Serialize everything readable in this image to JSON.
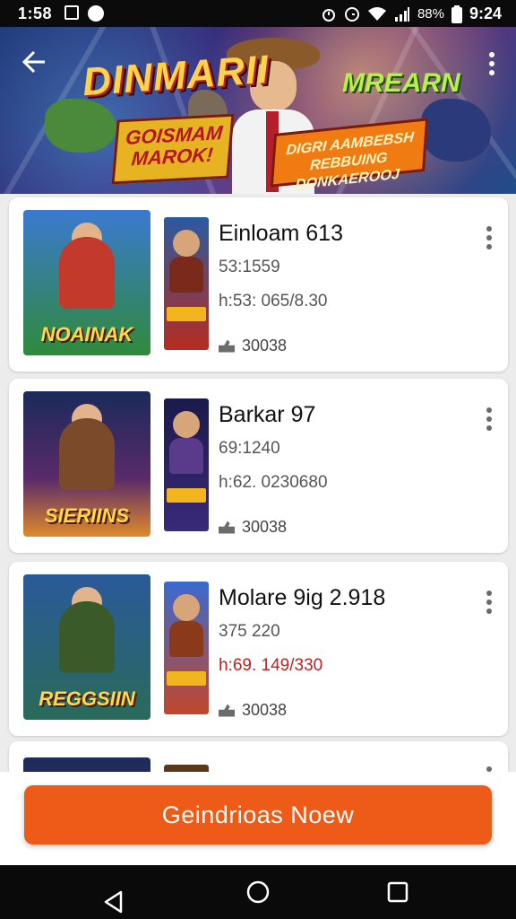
{
  "status_bar": {
    "time": "1:58",
    "battery": "88%",
    "clock_right": "9:24"
  },
  "banner": {
    "title_left": "DINMARII",
    "title_right": "MREARN",
    "ribbon_left": "GOISMAM MAROK!",
    "ribbon_right": "DIGRI AAMBEBSH REBBUING DONKAEROOJ"
  },
  "games": [
    {
      "title": "Einloam 613",
      "subtitle": "53:1559",
      "price": "h:53: 065/8.30",
      "price_highlight": false,
      "downloads": "30038",
      "cover_logo": "NOAINAK",
      "cover_bg": "#2f8a3a",
      "cover_char": "#c3392b",
      "thumb_bg": "#b72b1f"
    },
    {
      "title": "Barkar 97",
      "subtitle": "69:1240",
      "price": "h:62. 0230680",
      "price_highlight": false,
      "downloads": "30038",
      "cover_logo": "SIERIINS",
      "cover_bg": "#5a2a6a",
      "cover_char": "#7a4a2a",
      "thumb_bg": "#3a2a7a"
    },
    {
      "title": "Molare 9ig 2.918",
      "subtitle": "375 220",
      "price": "h:69. 149/330",
      "price_highlight": true,
      "downloads": "30038",
      "cover_logo": "REGGSIIN",
      "cover_bg": "#2a6a5a",
      "cover_char": "#3a5a2a",
      "thumb_bg": "#c2462a"
    }
  ],
  "cta": {
    "label": "Geindrioas Noew"
  },
  "colors": {
    "accent": "#ee5a17",
    "price_red": "#c0201e"
  }
}
